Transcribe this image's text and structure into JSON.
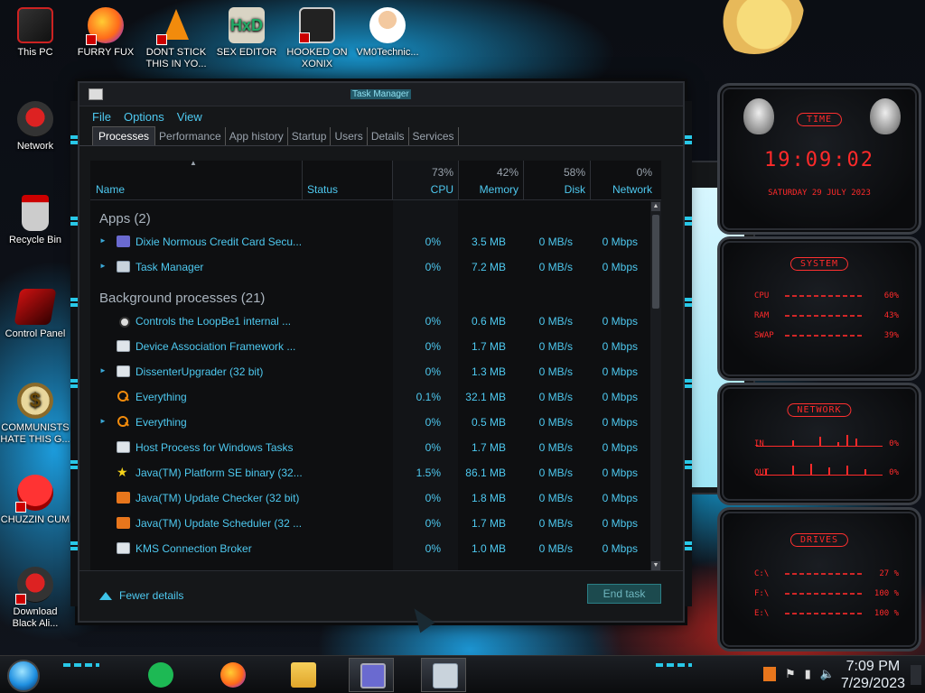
{
  "desktop": {
    "icons": [
      {
        "label": "This PC"
      },
      {
        "label": "FURRY FUX"
      },
      {
        "label": "DONT STICK THIS IN YO..."
      },
      {
        "label": "SEX EDITOR"
      },
      {
        "label": "HOOKED ON XONIX"
      },
      {
        "label": "VM0Technic..."
      },
      {
        "label": "Network"
      },
      {
        "label": "Recycle Bin"
      },
      {
        "label": "Control Panel"
      },
      {
        "label": "COMMUNISTS HATE THIS G..."
      },
      {
        "label": "CHUZZIN CUM"
      },
      {
        "label": "Download Black Ali..."
      }
    ]
  },
  "task_manager": {
    "title": "Task Manager",
    "menu": [
      "File",
      "Options",
      "View"
    ],
    "tabs": [
      "Processes",
      "Performance",
      "App history",
      "Startup",
      "Users",
      "Details",
      "Services"
    ],
    "active_tab": "Processes",
    "columns": {
      "name": "Name",
      "status": "Status",
      "cpu_pct": "73%",
      "cpu": "CPU",
      "memory_pct": "42%",
      "memory": "Memory",
      "disk_pct": "58%",
      "disk": "Disk",
      "network_pct": "0%",
      "network": "Network"
    },
    "groups": {
      "apps": "Apps (2)",
      "background": "Background processes (21)"
    },
    "apps": [
      {
        "name": "Dixie Normous Credit Card Secu...",
        "cpu": "0%",
        "memory": "3.5 MB",
        "disk": "0 MB/s",
        "network": "0 Mbps",
        "icon": "card-icon",
        "expandable": true
      },
      {
        "name": "Task Manager",
        "cpu": "0%",
        "memory": "7.2 MB",
        "disk": "0 MB/s",
        "network": "0 Mbps",
        "icon": "task-manager-icon",
        "expandable": true
      }
    ],
    "background": [
      {
        "name": "Controls the LoopBe1 internal ...",
        "cpu": "0%",
        "memory": "0.6 MB",
        "disk": "0 MB/s",
        "network": "0 Mbps",
        "icon": "loopbe-icon",
        "expandable": false
      },
      {
        "name": "Device Association Framework ...",
        "cpu": "0%",
        "memory": "1.7 MB",
        "disk": "0 MB/s",
        "network": "0 Mbps",
        "icon": "window-icon",
        "expandable": false
      },
      {
        "name": "DissenterUpgrader (32 bit)",
        "cpu": "0%",
        "memory": "1.3 MB",
        "disk": "0 MB/s",
        "network": "0 Mbps",
        "icon": "window-icon",
        "expandable": true
      },
      {
        "name": "Everything",
        "cpu": "0.1%",
        "memory": "32.1 MB",
        "disk": "0 MB/s",
        "network": "0 Mbps",
        "icon": "search-icon",
        "expandable": false
      },
      {
        "name": "Everything",
        "cpu": "0%",
        "memory": "0.5 MB",
        "disk": "0 MB/s",
        "network": "0 Mbps",
        "icon": "search-icon",
        "expandable": true
      },
      {
        "name": "Host Process for Windows Tasks",
        "cpu": "0%",
        "memory": "1.7 MB",
        "disk": "0 MB/s",
        "network": "0 Mbps",
        "icon": "window-icon",
        "expandable": false
      },
      {
        "name": "Java(TM) Platform SE binary (32...",
        "cpu": "1.5%",
        "memory": "86.1 MB",
        "disk": "0 MB/s",
        "network": "0 Mbps",
        "icon": "star-icon",
        "expandable": false
      },
      {
        "name": "Java(TM) Update Checker (32 bit)",
        "cpu": "0%",
        "memory": "1.8 MB",
        "disk": "0 MB/s",
        "network": "0 Mbps",
        "icon": "java-icon",
        "expandable": false
      },
      {
        "name": "Java(TM) Update Scheduler (32 ...",
        "cpu": "0%",
        "memory": "1.7 MB",
        "disk": "0 MB/s",
        "network": "0 Mbps",
        "icon": "java-icon",
        "expandable": false
      },
      {
        "name": "KMS Connection Broker",
        "cpu": "0%",
        "memory": "1.0 MB",
        "disk": "0 MB/s",
        "network": "0 Mbps",
        "icon": "window-icon",
        "expandable": false
      }
    ],
    "footer": {
      "fewer_details": "Fewer details",
      "end_task": "End task"
    }
  },
  "gadgets": {
    "time": {
      "title": "TIME",
      "clock": "19:09:02",
      "date": "SATURDAY 29 JULY 2023"
    },
    "system": {
      "title": "SYSTEM",
      "rows": [
        {
          "label": "CPU",
          "value": "60%"
        },
        {
          "label": "RAM",
          "value": "43%"
        },
        {
          "label": "SWAP",
          "value": "39%"
        }
      ]
    },
    "network": {
      "title": "NETWORK",
      "rows": [
        {
          "label": "IN",
          "value": "0%"
        },
        {
          "label": "OUT",
          "value": "0%"
        }
      ]
    },
    "drives": {
      "title": "DRIVES",
      "rows": [
        {
          "label": "C:\\",
          "value": "27 %"
        },
        {
          "label": "F:\\",
          "value": "100 %"
        },
        {
          "label": "E:\\",
          "value": "100 %"
        }
      ]
    }
  },
  "taskbar": {
    "time": "7:09 PM",
    "date": "7/29/2023",
    "pinned": [
      "notes-icon",
      "firefox-icon",
      "file-explorer-icon",
      "card-icon",
      "task-manager-icon"
    ]
  }
}
